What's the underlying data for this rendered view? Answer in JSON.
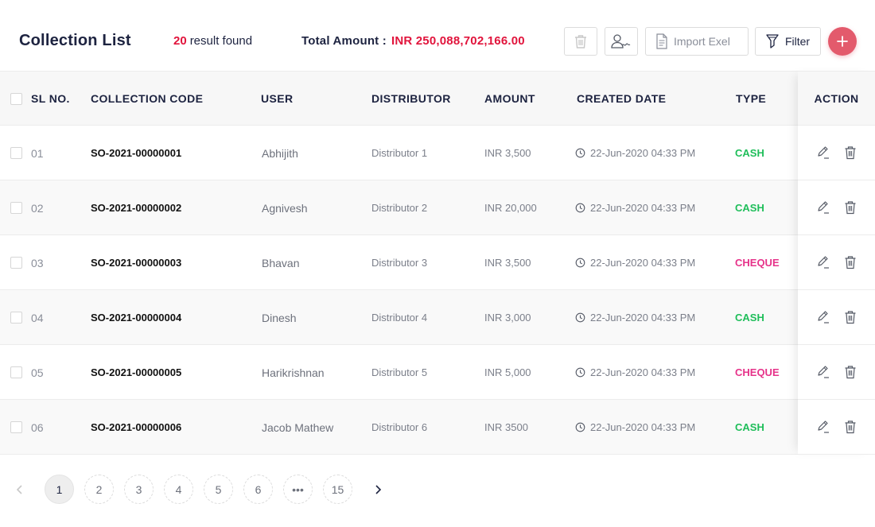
{
  "header": {
    "title": "Collection List",
    "result_count": "20",
    "result_text": "result found",
    "total_label": "Total Amount :",
    "total_value": "INR 250,088,702,166.00",
    "import_label": "Import Exel",
    "filter_label": "Filter"
  },
  "table": {
    "columns": {
      "slno": "SL NO.",
      "code": "COLLECTION CODE",
      "user": "USER",
      "distributor": "DISTRIBUTOR",
      "amount": "AMOUNT",
      "created": "CREATED DATE",
      "type": "TYPE",
      "action": "ACTION"
    },
    "rows": [
      {
        "slno": "01",
        "code": "SO-2021-00000001",
        "user": "Abhijith",
        "distributor": "Distributor 1",
        "amount": "INR 3,500",
        "created": "22-Jun-2020 04:33 PM",
        "type": "CASH"
      },
      {
        "slno": "02",
        "code": "SO-2021-00000002",
        "user": "Agnivesh",
        "distributor": "Distributor 2",
        "amount": "INR 20,000",
        "created": "22-Jun-2020 04:33 PM",
        "type": "CASH"
      },
      {
        "slno": "03",
        "code": "SO-2021-00000003",
        "user": "Bhavan",
        "distributor": "Distributor 3",
        "amount": "INR 3,500",
        "created": "22-Jun-2020 04:33 PM",
        "type": "CHEQUE"
      },
      {
        "slno": "04",
        "code": "SO-2021-00000004",
        "user": "Dinesh",
        "distributor": "Distributor 4",
        "amount": "INR 3,000",
        "created": "22-Jun-2020 04:33 PM",
        "type": "CASH"
      },
      {
        "slno": "05",
        "code": "SO-2021-00000005",
        "user": "Harikrishnan",
        "distributor": "Distributor 5",
        "amount": "INR 5,000",
        "created": "22-Jun-2020 04:33 PM",
        "type": "CHEQUE"
      },
      {
        "slno": "06",
        "code": "SO-2021-00000006",
        "user": "Jacob Mathew",
        "distributor": "Distributor 6",
        "amount": "INR 3500",
        "created": "22-Jun-2020 04:33 PM",
        "type": "CASH"
      }
    ]
  },
  "pagination": {
    "pages": [
      "1",
      "2",
      "3",
      "4",
      "5",
      "6",
      "•••",
      "15"
    ],
    "active": "1"
  },
  "colors": {
    "accent_red": "#e1143c",
    "add_button": "#e35a6c",
    "cash": "#1fbe5a",
    "cheque": "#e6338a"
  },
  "icons": {
    "toolbar": [
      "trash-icon",
      "user-signature-icon",
      "document-icon",
      "filter-funnel-icon",
      "plus-icon"
    ],
    "row": [
      "clock-icon",
      "edit-pencil-icon",
      "trash-icon"
    ],
    "pagination": [
      "chevron-left-icon",
      "chevron-right-icon"
    ]
  }
}
